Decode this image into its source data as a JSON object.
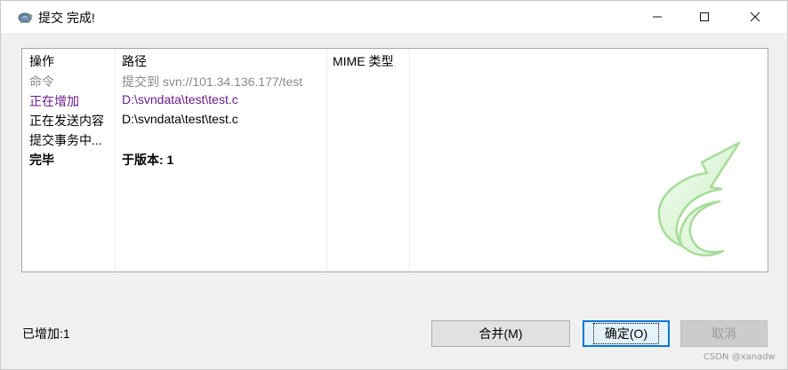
{
  "window": {
    "title": "提交 完成!",
    "minimize_glyph": "—",
    "maximize_glyph": "☐",
    "close_glyph": "✕"
  },
  "list": {
    "columns": [
      "操作",
      "路径",
      "MIME 类型"
    ],
    "rows": [
      {
        "action": "命令",
        "path": "提交到 svn://101.34.136.177/test",
        "mime": "",
        "style": "gray"
      },
      {
        "action": "正在增加",
        "path": "D:\\svndata\\test\\test.c",
        "mime": "",
        "style": "purple"
      },
      {
        "action": "正在发送内容",
        "path": "D:\\svndata\\test\\test.c",
        "mime": "",
        "style": "black"
      },
      {
        "action": "提交事务中...",
        "path": "",
        "mime": "",
        "style": "black"
      },
      {
        "action": "完毕",
        "path": "于版本: 1",
        "mime": "",
        "style": "bold"
      }
    ]
  },
  "status": {
    "added_label": "已增加:1"
  },
  "buttons": {
    "merge": "合并(M)",
    "ok": "确定(O)",
    "cancel": "取消"
  },
  "watermark": "CSDN @xanadw",
  "colors": {
    "command_row": "#8a8a8a",
    "added_row": "#6a1b8a",
    "arrow_fill": "#d9f5d4",
    "arrow_stroke": "#9ad38c",
    "default_button_border": "#0078d7"
  }
}
